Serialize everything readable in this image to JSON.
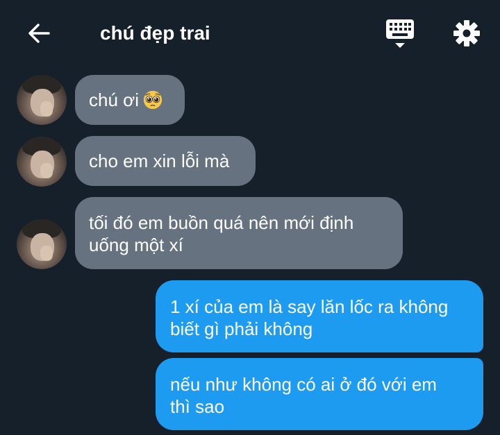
{
  "header": {
    "title": "chú đẹp trai",
    "back_icon": "arrow-left-icon",
    "keyboard_icon": "keyboard-icon",
    "settings_icon": "gear-icon"
  },
  "messages": [
    {
      "direction": "incoming",
      "lines": [
        "chú ơi"
      ],
      "emoji": "pleading-face-emoji"
    },
    {
      "direction": "incoming",
      "lines": [
        "cho em xin lỗi mà"
      ]
    },
    {
      "direction": "incoming",
      "lines": [
        "tối đó em buồn quá nên mới định",
        "uống một xí"
      ]
    },
    {
      "direction": "outgoing",
      "lines": [
        "1 xí của em là say lăn lốc ra không",
        "biết gì phải không"
      ]
    },
    {
      "direction": "outgoing",
      "lines": [
        "nếu như không có ai ở đó với em",
        "thì sao"
      ]
    }
  ],
  "colors": {
    "background": "#15202b",
    "incoming_bubble": "#66727f",
    "outgoing_bubble": "#1d9bf0"
  }
}
